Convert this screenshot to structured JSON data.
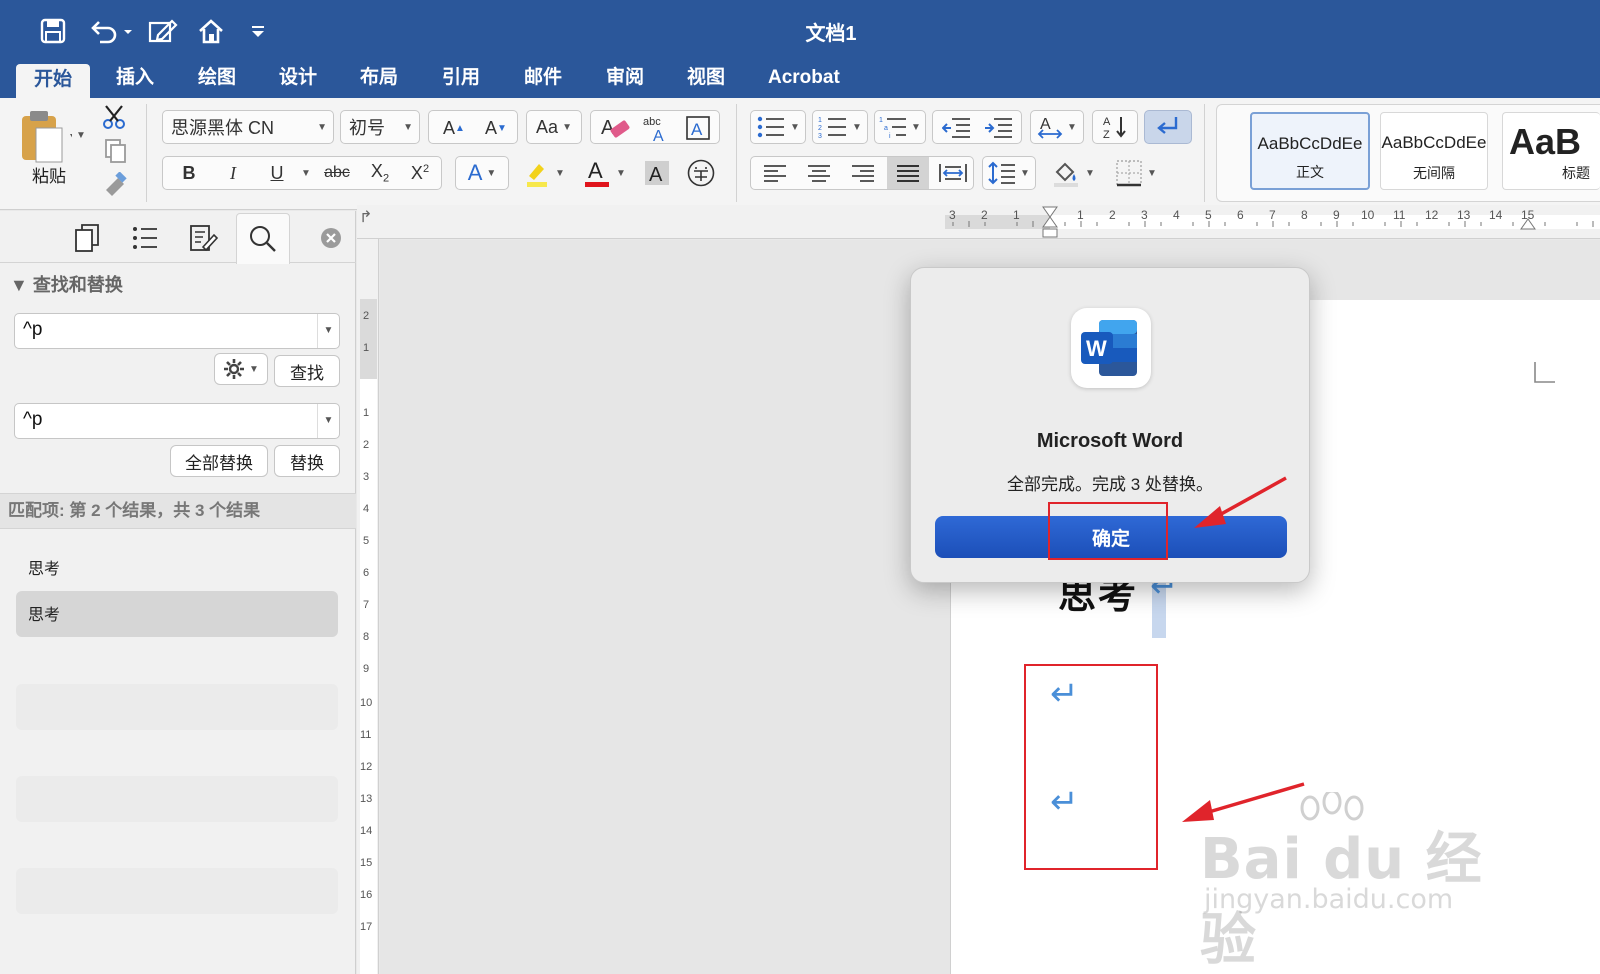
{
  "window": {
    "title": "文档1"
  },
  "tabs": [
    "开始",
    "插入",
    "绘图",
    "设计",
    "布局",
    "引用",
    "邮件",
    "审阅",
    "视图",
    "Acrobat"
  ],
  "ribbon": {
    "paste_label": "粘贴",
    "font_name": "思源黑体 CN",
    "font_size": "初号",
    "styles": [
      {
        "sample": "AaBbCcDdEe",
        "name": "正文"
      },
      {
        "sample": "AaBbCcDdEe",
        "name": "无间隔"
      },
      {
        "sample": "AaB",
        "name": "标题"
      }
    ]
  },
  "find_replace": {
    "header": "▼ 查找和替换",
    "search_value": "^p",
    "find_button": "查找",
    "replace_value": "^p",
    "replace_all_button": "全部替换",
    "replace_button": "替换",
    "match_status": "匹配项: 第 2 个结果，共 3 个结果",
    "results": [
      "思考",
      "思考"
    ]
  },
  "document": {
    "heading_text": "思考",
    "paragraph_mark": "↵"
  },
  "dialog": {
    "app_name": "Microsoft Word",
    "message": "全部完成。完成 3 处替换。",
    "ok_label": "确定",
    "icon_letter": "W"
  },
  "watermark": {
    "main": "Bai du 经验",
    "sub": "jingyan.baidu.com"
  },
  "colors": {
    "accent": "#2b579a",
    "button": "#1c4fb8",
    "annotation": "#e0242b",
    "paragraph_mark": "#4a8fd8"
  }
}
